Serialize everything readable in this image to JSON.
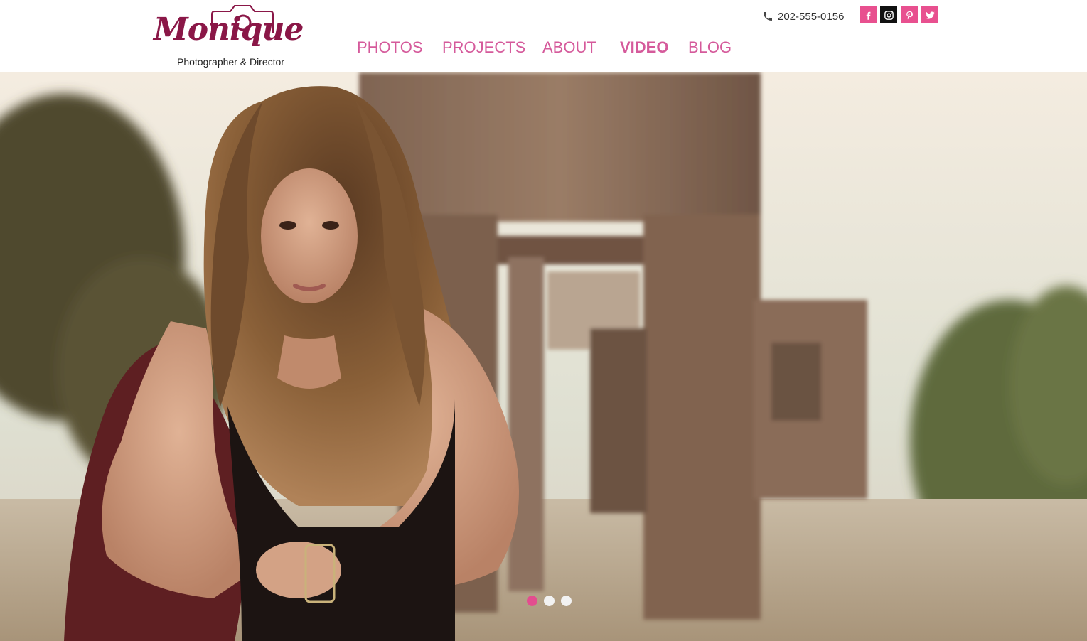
{
  "brand": {
    "name": "Monique",
    "tagline": "Photographer & Director",
    "color": "#8a1747"
  },
  "nav": {
    "items": [
      {
        "label": "PHOTOS"
      },
      {
        "label": "PROJECTS"
      },
      {
        "label": "ABOUT"
      },
      {
        "label": "VIDEO"
      },
      {
        "label": "BLOG"
      }
    ],
    "active_label": "VIDEO",
    "color": "#d55a9b"
  },
  "contact": {
    "phone": "202-555-0156",
    "icon": "phone-icon"
  },
  "social": [
    {
      "icon": "facebook-icon",
      "color": "#e8508f"
    },
    {
      "icon": "instagram-icon",
      "color": "#111111"
    },
    {
      "icon": "pinterest-icon",
      "color": "#e8508f"
    },
    {
      "icon": "twitter-icon",
      "color": "#e8508f"
    }
  ],
  "hero": {
    "slide_count": 3,
    "active_slide": 1,
    "dot_active_color": "#e34d8f"
  }
}
